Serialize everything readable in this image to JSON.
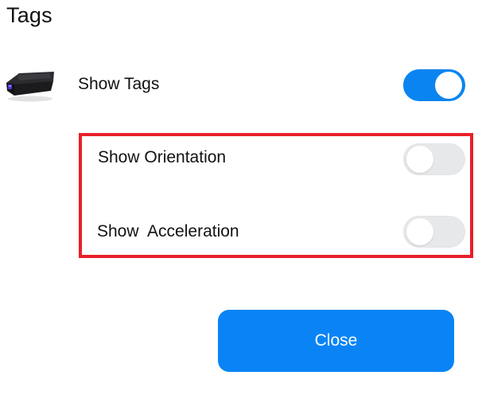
{
  "dialog": {
    "title": "Tags"
  },
  "device": {
    "icon": "tag-device-icon"
  },
  "settings": {
    "show_tags": {
      "label": "Show Tags",
      "enabled": true
    },
    "show_orientation": {
      "label": "Show Orientation",
      "enabled": false
    },
    "show_acceleration": {
      "label": "Show  Acceleration",
      "enabled": false
    }
  },
  "footer": {
    "close_label": "Close"
  },
  "colors": {
    "accent": "#0a84f5",
    "highlight": "#e8202a",
    "toggle_off": "#e6e8ea"
  }
}
